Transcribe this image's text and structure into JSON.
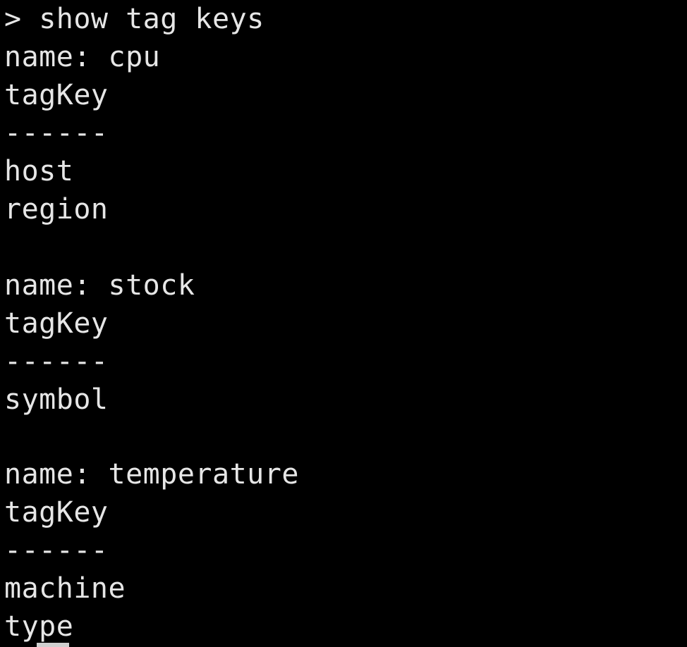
{
  "terminal": {
    "prompt_symbol": ">",
    "command": "show tag keys",
    "results": [
      {
        "name_line": "name: cpu",
        "column_header": "tagKey",
        "separator": "------",
        "values": [
          "host",
          "region"
        ]
      },
      {
        "name_line": "name: stock",
        "column_header": "tagKey",
        "separator": "------",
        "values": [
          "symbol"
        ]
      },
      {
        "name_line": "name: temperature",
        "column_header": "tagKey",
        "separator": "------",
        "values": [
          "machine",
          "type"
        ]
      }
    ],
    "colors": {
      "background": "#000000",
      "text": "#e6e6e6"
    }
  }
}
